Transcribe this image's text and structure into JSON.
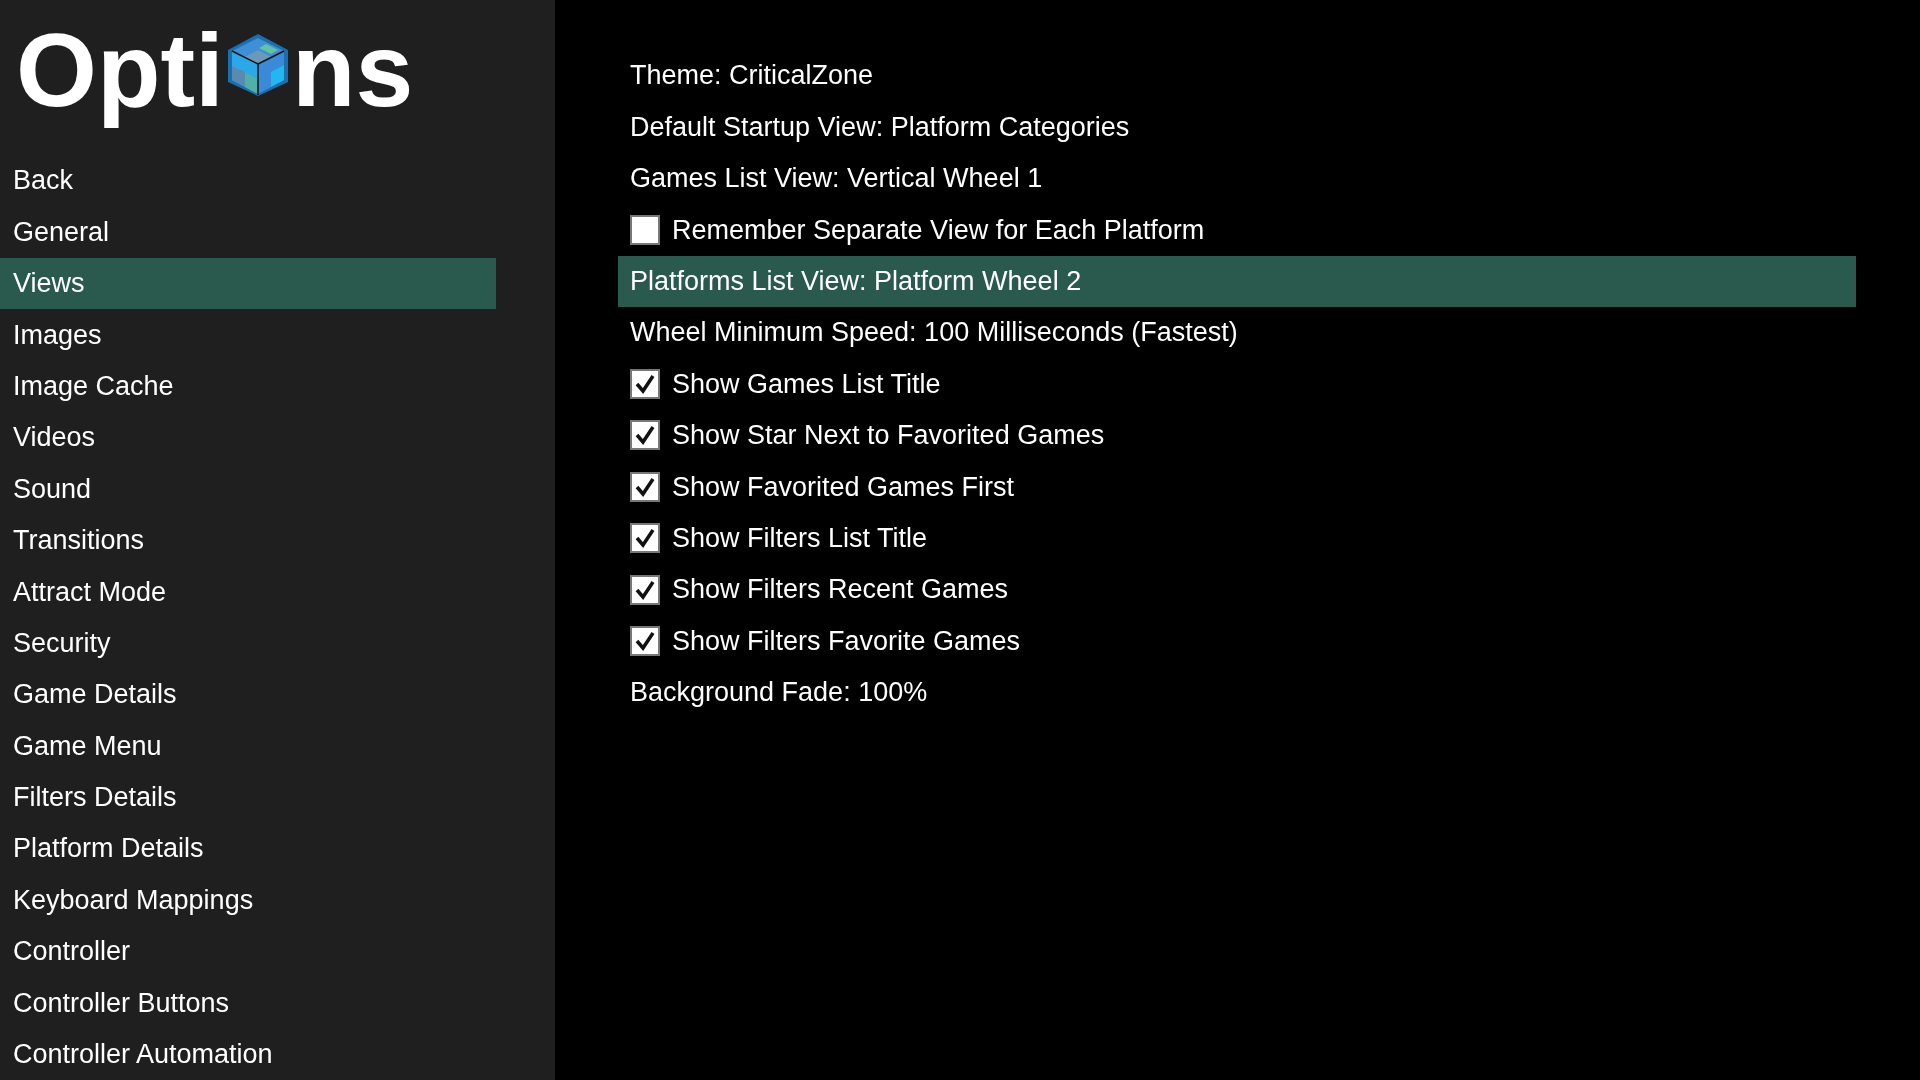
{
  "logo": {
    "text_before": "Opti",
    "text_after": "ns"
  },
  "sidebar": {
    "items": [
      {
        "label": "Back",
        "selected": false
      },
      {
        "label": "General",
        "selected": false
      },
      {
        "label": "Views",
        "selected": true
      },
      {
        "label": "Images",
        "selected": false
      },
      {
        "label": "Image Cache",
        "selected": false
      },
      {
        "label": "Videos",
        "selected": false
      },
      {
        "label": "Sound",
        "selected": false
      },
      {
        "label": "Transitions",
        "selected": false
      },
      {
        "label": "Attract Mode",
        "selected": false
      },
      {
        "label": "Security",
        "selected": false
      },
      {
        "label": "Game Details",
        "selected": false
      },
      {
        "label": "Game Menu",
        "selected": false
      },
      {
        "label": "Filters Details",
        "selected": false
      },
      {
        "label": "Platform Details",
        "selected": false
      },
      {
        "label": "Keyboard Mappings",
        "selected": false
      },
      {
        "label": "Controller",
        "selected": false
      },
      {
        "label": "Controller Buttons",
        "selected": false
      },
      {
        "label": "Controller Automation",
        "selected": false
      }
    ]
  },
  "settings": [
    {
      "kind": "value",
      "label": "Theme: CriticalZone",
      "selected": false
    },
    {
      "kind": "value",
      "label": "Default Startup View: Platform Categories",
      "selected": false
    },
    {
      "kind": "value",
      "label": "Games List View: Vertical Wheel 1",
      "selected": false
    },
    {
      "kind": "checkbox",
      "label": "Remember Separate View for Each Platform",
      "checked": false,
      "selected": false
    },
    {
      "kind": "value",
      "label": "Platforms List View: Platform Wheel 2",
      "selected": true
    },
    {
      "kind": "value",
      "label": "Wheel Minimum Speed: 100 Milliseconds (Fastest)",
      "selected": false
    },
    {
      "kind": "checkbox",
      "label": "Show Games List Title",
      "checked": true,
      "selected": false
    },
    {
      "kind": "checkbox",
      "label": "Show Star Next to Favorited Games",
      "checked": true,
      "selected": false
    },
    {
      "kind": "checkbox",
      "label": "Show Favorited Games First",
      "checked": true,
      "selected": false
    },
    {
      "kind": "checkbox",
      "label": "Show Filters List Title",
      "checked": true,
      "selected": false
    },
    {
      "kind": "checkbox",
      "label": "Show Filters Recent Games",
      "checked": true,
      "selected": false
    },
    {
      "kind": "checkbox",
      "label": "Show Filters Favorite Games",
      "checked": true,
      "selected": false
    },
    {
      "kind": "value",
      "label": "Background Fade: 100%",
      "selected": false
    }
  ]
}
